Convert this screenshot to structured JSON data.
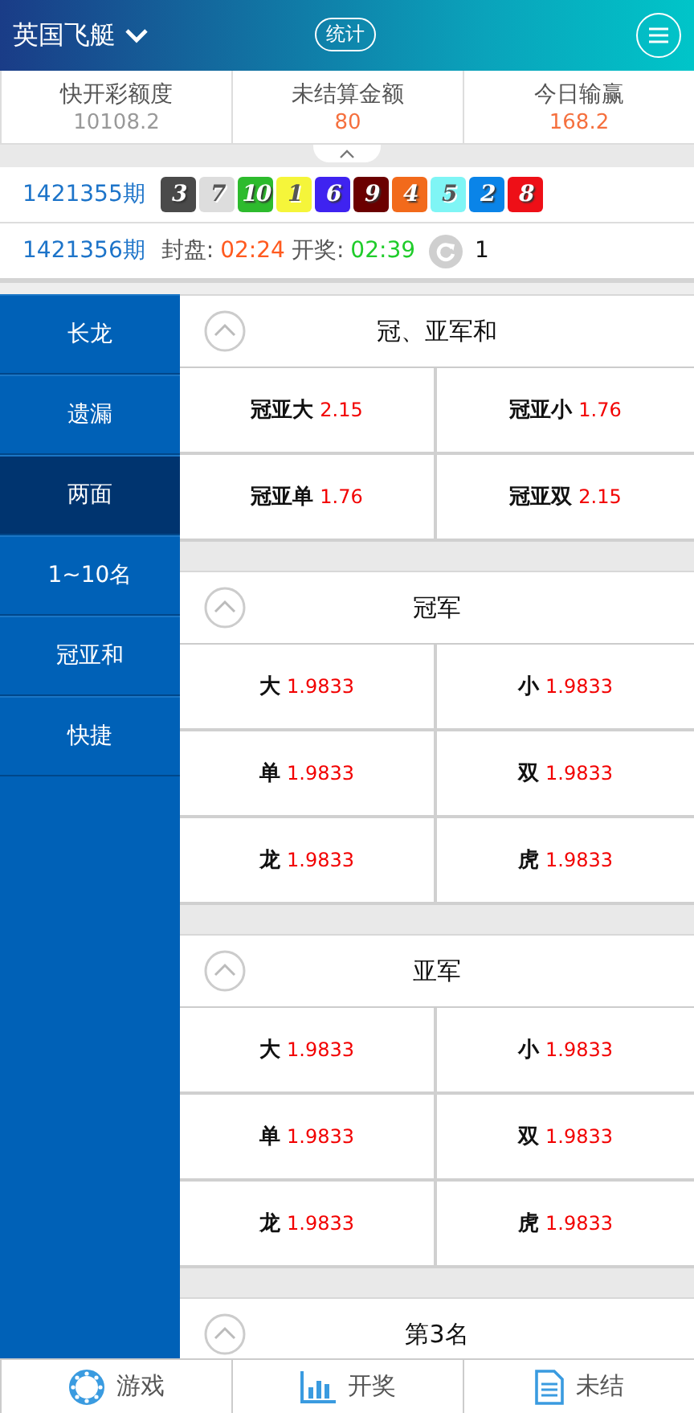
{
  "header": {
    "game": "英国飞艇",
    "stats_button": "统计"
  },
  "summary": [
    {
      "label": "快开彩额度",
      "value": "10108.2",
      "kind": "muted"
    },
    {
      "label": "未结算金额",
      "value": "80",
      "kind": "accent"
    },
    {
      "label": "今日输赢",
      "value": "168.2",
      "kind": "accent"
    }
  ],
  "last_draw": {
    "period": "1421355期",
    "balls": [
      {
        "number": "3",
        "color": "#4a4a4a"
      },
      {
        "number": "7",
        "color": "#dddddd"
      },
      {
        "number": "10",
        "color": "#2dbb2d"
      },
      {
        "number": "1",
        "color": "#f5f53a"
      },
      {
        "number": "6",
        "color": "#3f23f0"
      },
      {
        "number": "9",
        "color": "#6b0000"
      },
      {
        "number": "4",
        "color": "#f26a1b"
      },
      {
        "number": "5",
        "color": "#7ff5f5"
      },
      {
        "number": "2",
        "color": "#0a84e8"
      },
      {
        "number": "8",
        "color": "#ee0f17"
      }
    ]
  },
  "next_draw": {
    "period": "1421356期",
    "close_label": "封盘:",
    "close_time": "02:24",
    "open_label": "开奖:",
    "open_time": "02:39",
    "count": "1"
  },
  "sidebar": [
    {
      "label": "长龙",
      "selected": false
    },
    {
      "label": "遗漏",
      "selected": false
    },
    {
      "label": "两面",
      "selected": true
    },
    {
      "label": "1~10名",
      "selected": false
    },
    {
      "label": "冠亚和",
      "selected": false
    },
    {
      "label": "快捷",
      "selected": false
    }
  ],
  "sections": [
    {
      "title": "冠、亚军和",
      "cells": [
        {
          "label": "冠亚大",
          "odds": "2.15"
        },
        {
          "label": "冠亚小",
          "odds": "1.76"
        },
        {
          "label": "冠亚单",
          "odds": "1.76"
        },
        {
          "label": "冠亚双",
          "odds": "2.15"
        }
      ]
    },
    {
      "title": "冠军",
      "cells": [
        {
          "label": "大",
          "odds": "1.9833"
        },
        {
          "label": "小",
          "odds": "1.9833"
        },
        {
          "label": "单",
          "odds": "1.9833"
        },
        {
          "label": "双",
          "odds": "1.9833"
        },
        {
          "label": "龙",
          "odds": "1.9833"
        },
        {
          "label": "虎",
          "odds": "1.9833"
        }
      ]
    },
    {
      "title": "亚军",
      "cells": [
        {
          "label": "大",
          "odds": "1.9833"
        },
        {
          "label": "小",
          "odds": "1.9833"
        },
        {
          "label": "单",
          "odds": "1.9833"
        },
        {
          "label": "双",
          "odds": "1.9833"
        },
        {
          "label": "龙",
          "odds": "1.9833"
        },
        {
          "label": "虎",
          "odds": "1.9833"
        }
      ]
    },
    {
      "title": "第3名"
    }
  ],
  "bottom_nav": [
    {
      "label": "游戏",
      "kind": "game"
    },
    {
      "label": "开奖",
      "kind": "chart"
    },
    {
      "label": "未结",
      "kind": "document"
    }
  ]
}
